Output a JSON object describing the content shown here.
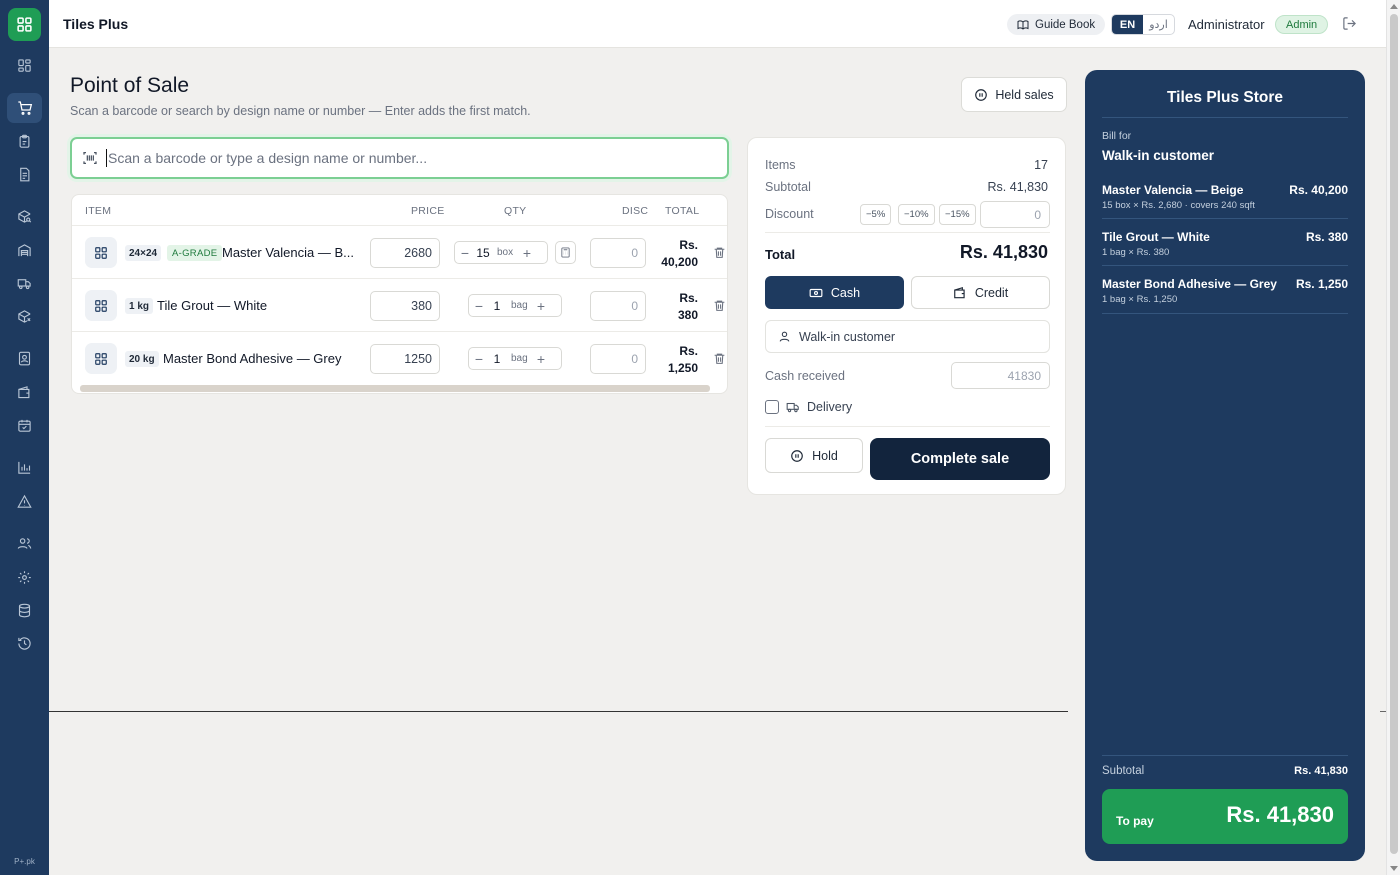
{
  "app": {
    "brand": "Tiles Plus",
    "footer": "P+.pk",
    "accent": "#1e3a5f",
    "brand_green": "#1f9d55"
  },
  "topbar": {
    "guide_label": "Guide Book",
    "lang_en": "EN",
    "lang_ur": "اردو",
    "user_name": "Administrator",
    "role_badge": "Admin"
  },
  "sidebar": {
    "items": [
      {
        "icon": "dashboard-icon"
      },
      {
        "icon": "cart-icon",
        "active": true
      },
      {
        "icon": "clipboard-icon"
      },
      {
        "icon": "receipt-icon"
      },
      {
        "icon": "box-search-icon"
      },
      {
        "icon": "warehouse-icon"
      },
      {
        "icon": "truck-icon"
      },
      {
        "icon": "box-x-icon"
      },
      {
        "icon": "contact-icon"
      },
      {
        "icon": "wallet-icon"
      },
      {
        "icon": "calendar-check-icon"
      },
      {
        "icon": "bar-chart-icon"
      },
      {
        "icon": "alert-icon"
      },
      {
        "icon": "users-icon"
      },
      {
        "icon": "settings-icon"
      },
      {
        "icon": "database-icon"
      },
      {
        "icon": "history-icon"
      }
    ]
  },
  "page": {
    "title": "Point of Sale",
    "subtitle": "Scan a barcode or search by design name or number — Enter adds the first match.",
    "held_sales_label": "Held sales",
    "search_placeholder": "Scan a barcode or type a design name or number..."
  },
  "cart": {
    "headers": {
      "item": "ITEM",
      "price": "PRICE",
      "qty": "QTY",
      "disc": "DISC",
      "total": "TOTAL"
    },
    "rows": [
      {
        "size": "24×24",
        "grade": "A-GRADE",
        "name": "Master Valencia — B...",
        "price": "2680",
        "qty": "15",
        "unit": "box",
        "disc": "0",
        "total_cur": "Rs.",
        "total_amt": "40,200",
        "has_calc": true
      },
      {
        "size": "1 kg",
        "grade": "",
        "name": "Tile Grout — White",
        "price": "380",
        "qty": "1",
        "unit": "bag",
        "disc": "0",
        "total_cur": "Rs.",
        "total_amt": "380",
        "has_calc": false
      },
      {
        "size": "20 kg",
        "grade": "",
        "name": "Master Bond Adhesive — Grey",
        "price": "1250",
        "qty": "1",
        "unit": "bag",
        "disc": "0",
        "total_cur": "Rs.",
        "total_amt": "1,250",
        "has_calc": false
      }
    ]
  },
  "summary": {
    "items_label": "Items",
    "items_value": "17",
    "subtotal_label": "Subtotal",
    "subtotal_value": "Rs. 41,830",
    "discount_label": "Discount",
    "discount_presets": [
      "−5%",
      "−10%",
      "−15%"
    ],
    "discount_value": "0",
    "total_label": "Total",
    "total_value": "Rs. 41,830",
    "cash_label": "Cash",
    "credit_label": "Credit",
    "customer": "Walk-in customer",
    "cash_received_label": "Cash received",
    "cash_received_value": "41830",
    "delivery_label": "Delivery",
    "hold_label": "Hold",
    "complete_label": "Complete sale"
  },
  "receipt": {
    "store": "Tiles Plus Store",
    "bill_for_label": "Bill for",
    "customer": "Walk-in customer",
    "items": [
      {
        "name": "Master Valencia — Beige",
        "amount": "Rs. 40,200",
        "detail": "15 box × Rs. 2,680 · covers 240 sqft"
      },
      {
        "name": "Tile Grout — White",
        "amount": "Rs. 380",
        "detail": "1 bag × Rs. 380"
      },
      {
        "name": "Master Bond Adhesive — Grey",
        "amount": "Rs. 1,250",
        "detail": "1 bag × Rs. 1,250"
      }
    ],
    "subtotal_label": "Subtotal",
    "subtotal_value": "Rs. 41,830",
    "to_pay_label": "To pay",
    "to_pay_value": "Rs. 41,830"
  }
}
